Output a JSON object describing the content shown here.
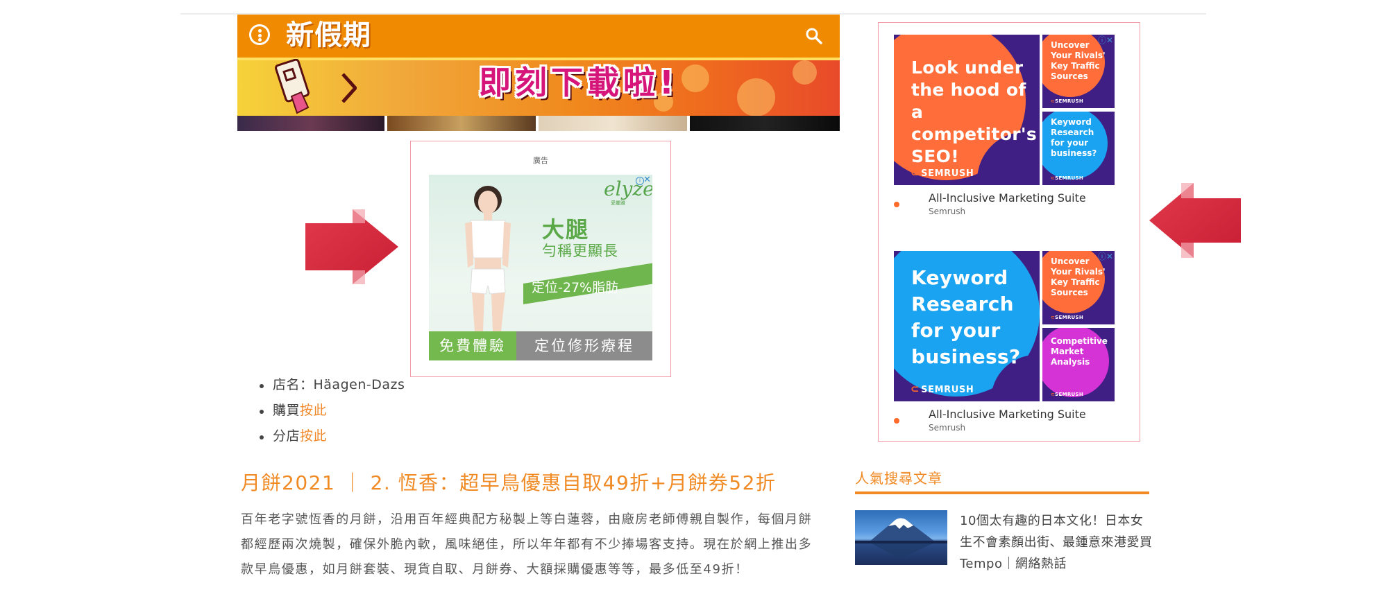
{
  "app_banner": {
    "logo": "新假期",
    "cta": "即刻下載啦!",
    "menu_icon": "menu-dots-icon",
    "search_icon": "search-icon"
  },
  "center_ad": {
    "label": "廣告",
    "brand": "elyze",
    "brand_sub": "愛麗雅",
    "headline": "大腿",
    "subheadline": "勻稱更顯長",
    "tag": "定位-27%脂肪",
    "button_left": "免費體驗",
    "button_right": "定位修形療程"
  },
  "store_list": [
    {
      "text": "店名：Häagen-Dazs",
      "link": ""
    },
    {
      "text": "購買",
      "link": "按此"
    },
    {
      "text": "分店",
      "link": "按此"
    }
  ],
  "article": {
    "heading": "月餅2021 ｜ 2. 恆香：超早鳥優惠自取49折+月餅券52折",
    "body_lines": [
      "百年老字號恆香的月餅，沿用百年經典配方秘製上等白蓮蓉，由廠房老師傅親自製作，每個月餅",
      "都經歷兩次燒製，確保外脆內軟，風味絕佳，所以年年都有不少捧場客支持。現在於網上推出多",
      "款早鳥優惠，如月餅套裝、現貨自取、月餅券、大額採購優惠等等，最多低至49折！"
    ]
  },
  "right_ads": [
    {
      "big_text": [
        "Look under",
        "the hood of",
        "a competitor's",
        "SEO!"
      ],
      "logo": "SEMRUSH",
      "small_1": [
        "Uncover",
        "Your Rivals'",
        "Key Traffic",
        "Sources"
      ],
      "small_2": [
        "Keyword",
        "Research",
        "for your",
        "business?"
      ],
      "caption": "All-Inclusive Marketing Suite",
      "brand": "Semrush"
    },
    {
      "big_text": [
        "Keyword",
        "Research",
        "for your",
        "business?"
      ],
      "logo": "SEMRUSH",
      "small_1": [
        "Uncover",
        "Your Rivals'",
        "Key Traffic",
        "Sources"
      ],
      "small_2": [
        "Competitive",
        "Market",
        "Analysis"
      ],
      "caption": "All-Inclusive Marketing Suite",
      "brand": "Semrush"
    }
  ],
  "sidebar": {
    "title": "人氣搜尋文章",
    "item_text": "10個太有趣的日本文化！日本女生不會素顏出街、最鍾意來港愛買Tempo｜網絡熱話"
  },
  "colors": {
    "accent": "#f08a24",
    "semrush_purple": "#401f84",
    "ad_border": "#f39aa7",
    "arrow_red": "#d8283c"
  }
}
